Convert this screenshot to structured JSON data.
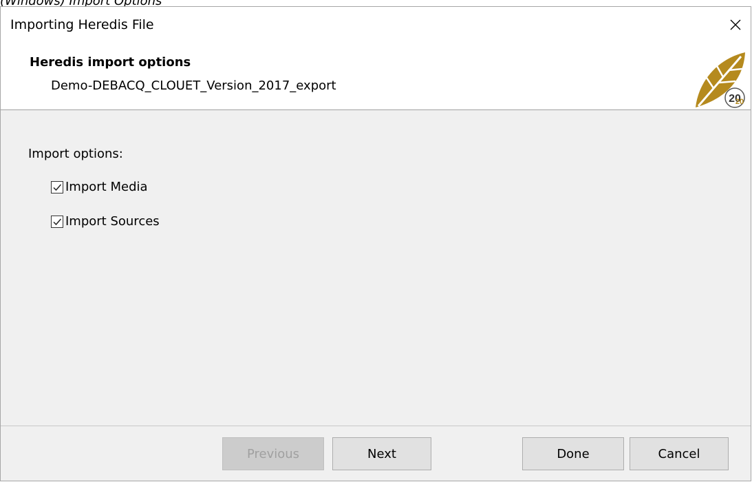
{
  "caption": "(Windows) Import Options",
  "window": {
    "title": "Importing Heredis File",
    "close_icon": "close-icon"
  },
  "header": {
    "title": "Heredis import options",
    "subtitle": "Demo-DEBACQ_CLOUET_Version_2017_export",
    "logo_icon": "heredis-2020-logo-icon",
    "logo_text": "2020"
  },
  "options": {
    "label": "Import options:",
    "items": [
      {
        "label": "Import Media",
        "checked": true
      },
      {
        "label": "Import Sources",
        "checked": true
      }
    ]
  },
  "buttons": {
    "previous": "Previous",
    "next": "Next",
    "done": "Done",
    "cancel": "Cancel"
  },
  "colors": {
    "dialog_bg": "#f0f0f0",
    "button_bg": "#e1e1e1",
    "logo_gold": "#b58a1e"
  }
}
